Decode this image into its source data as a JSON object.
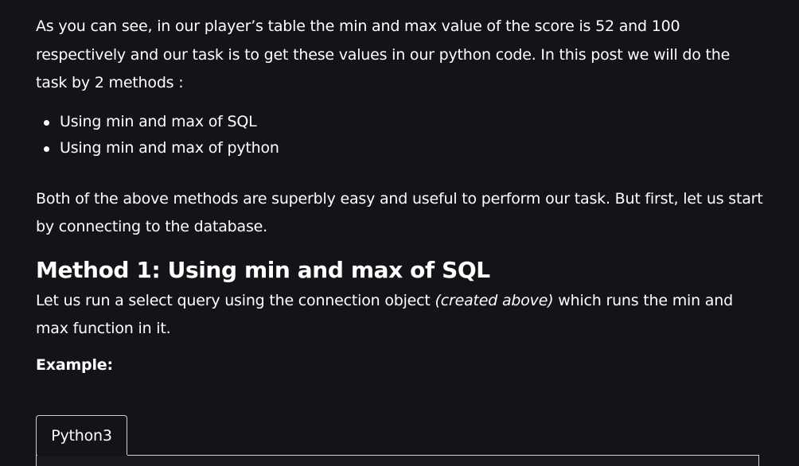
{
  "article": {
    "intro": "As you can see, in our player’s table the min and max value of the score is 52 and 100 respectively and our task is to get these values in our python code. In this post we will do the task by 2 methods :",
    "methods": [
      "Using min and max of SQL",
      "Using min and max of python"
    ],
    "both_methods": "Both of the above methods are superbly easy and useful to perform our task. But first, let us start by connecting to the database.",
    "method1": {
      "heading": "Method 1: Using min and max of SQL",
      "desc_before": "Let us run a select query using the connection object ",
      "desc_italic": "(created above)",
      "desc_after": " which runs the min and max function in it."
    },
    "example_label": "Example:",
    "code_tabs": [
      {
        "label": "Python3",
        "active": true
      }
    ]
  },
  "colors": {
    "background": "#131417",
    "text": "#ffffff",
    "tab_border": "#d0d0d0"
  }
}
